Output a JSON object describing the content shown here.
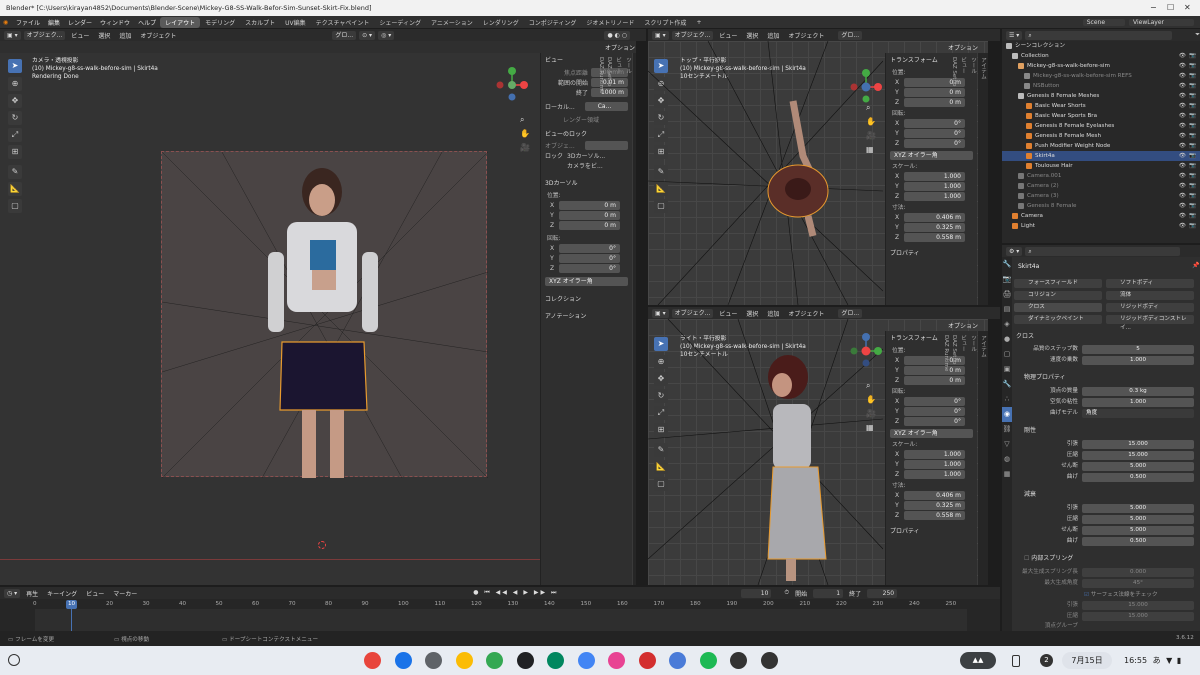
{
  "window": {
    "title": "Blender* [C:\\Users\\kirayan4852\\Documents\\Blender-Scene\\Mickey-G8-SS-Walk-Befor-Sim-Sunset-Skirt-Fix.blend]",
    "minimize": "−",
    "maximize": "☐",
    "close": "✕"
  },
  "menus": [
    "ファイル",
    "編集",
    "レンダー",
    "ウィンドウ",
    "ヘルプ"
  ],
  "workspaces": [
    "レイアウト",
    "モデリング",
    "スカルプト",
    "UV編集",
    "テクスチャペイント",
    "シェーディング",
    "アニメーション",
    "レンダリング",
    "コンポジティング",
    "ジオメトリノード",
    "スクリプト作成"
  ],
  "workspace_add": "+",
  "scene": {
    "name": "Scene",
    "view_layer": "ViewLayer"
  },
  "viewport_header": {
    "mode": "オブジェク...",
    "menus": [
      "ビュー",
      "選択",
      "追加",
      "オブジェクト"
    ],
    "transform": "グロ...",
    "options": "オプション"
  },
  "main_view": {
    "name": "カメラ・透視投影",
    "object": "(10) Mickey-g8-ss-walk-before-sim | Skirt4a",
    "status": "Rendering Done"
  },
  "top_view": {
    "name": "トップ・平行投影",
    "object": "(10) Mickey-g8-ss-walk-before-sim | Skirt4a",
    "scale": "10センチメートル"
  },
  "right_view": {
    "name": "ライト・平行投影",
    "object": "(10) Mickey-g8-ss-walk-before-sim | Skirt4a",
    "scale": "10センチメートル"
  },
  "view_panel": {
    "title": "ビュー",
    "focal_label": "焦点距離",
    "focal": "100 mm",
    "clip_start_label": "範囲の開始",
    "clip_start": "0.01 m",
    "clip_end_label": "終了",
    "clip_end": "1000 m",
    "local_camera_label": "ローカル...",
    "local_camera": "Ca...",
    "render_region": "レンダー領域",
    "lock_title": "ビューのロック",
    "lock_object_label": "オブジェ...",
    "lock_label": "ロック",
    "lock_3d_cursor": "3Dカーソル...",
    "camera_to_view": "カメラをビ...",
    "cursor_title": "3Dカーソル",
    "location_label": "位置:",
    "rotation_label": "回転:",
    "cursor_loc": [
      "0 m",
      "0 m",
      "0 m"
    ],
    "cursor_rot": [
      "0°",
      "0°",
      "0°"
    ],
    "rot_mode": "XYZ オイラー角",
    "collection": "コレクション",
    "annotation": "アノテーション"
  },
  "axes": [
    "X",
    "Y",
    "Z"
  ],
  "transform_panel": {
    "title": "トランスフォーム",
    "location_label": "位置:",
    "rotation_label": "回転:",
    "scale_label": "スケール:",
    "dims_label": "寸法:",
    "loc": [
      "0 m",
      "0 m",
      "0 m"
    ],
    "rot": [
      "0°",
      "0°",
      "0°"
    ],
    "rot_mode": "XYZ オイラー角",
    "scale": [
      "1.000",
      "1.000",
      "1.000"
    ],
    "dims": [
      "0.406 m",
      "0.325 m",
      "0.558 m"
    ],
    "properties": "プロパティ"
  },
  "side_tabs": [
    "アイテム",
    "ツール",
    "ビュー",
    "DAZ Setup",
    "DAZ Runtime"
  ],
  "outliner": {
    "root": "シーンコレクション",
    "items": [
      {
        "name": "Collection",
        "color": "#bbbbbb",
        "dim": false
      },
      {
        "name": "Mickey-g8-ss-walk-before-sim",
        "color": "#e0a060",
        "dim": false
      },
      {
        "name": "Mickey-g8-ss-walk-before-sim REFS",
        "color": "#888888",
        "dim": true
      },
      {
        "name": "NSButton",
        "color": "#888888",
        "dim": true
      },
      {
        "name": "Genesis 8 Female Meshes",
        "color": "#bbbbbb",
        "dim": false
      },
      {
        "name": "Basic Wear Shorts",
        "color": "#e08030",
        "dim": false
      },
      {
        "name": "Basic Wear Sports Bra",
        "color": "#e08030",
        "dim": false
      },
      {
        "name": "Genesis 8 Female Eyelashes",
        "color": "#e08030",
        "dim": false
      },
      {
        "name": "Genesis 8 Female Mesh",
        "color": "#e08030",
        "dim": false
      },
      {
        "name": "Push Modifier Weight Node",
        "color": "#e08030",
        "dim": false
      },
      {
        "name": "Skirt4a",
        "color": "#e08030",
        "dim": false,
        "selected": true
      },
      {
        "name": "Toulouse Hair",
        "color": "#e08030",
        "dim": false
      },
      {
        "name": "Camera.001",
        "color": "#777777",
        "dim": true
      },
      {
        "name": "Camera (2)",
        "color": "#777777",
        "dim": true
      },
      {
        "name": "Camera (3)",
        "color": "#777777",
        "dim": true
      },
      {
        "name": "Genesis 8 Female",
        "color": "#777777",
        "dim": true
      },
      {
        "name": "Camera",
        "color": "#e08030",
        "dim": false
      },
      {
        "name": "Light",
        "color": "#e08030",
        "dim": false
      }
    ]
  },
  "properties": {
    "object": "Skirt4a",
    "physics_buttons": [
      "フォースフィールド",
      "ソフトボディ",
      "コリジョン",
      "流体",
      "クロス",
      "リジッドボディ",
      "ダイナミックペイント",
      "リジッドボディコンストレイ..."
    ],
    "cloth_title": "クロス",
    "quality_label": "品質のステップ数",
    "quality": "5",
    "speed_label": "速度の乗数",
    "speed": "1.000",
    "phys_title": "物理プロパティ",
    "mass_label": "頂点の質量",
    "mass": "0.3 kg",
    "air_label": "空気の粘性",
    "air": "1.000",
    "bend_model_label": "曲げモデル",
    "bend_model": "角度",
    "stiff_title": "剛性",
    "tension_label": "引張",
    "tension": "15.000",
    "compress_label": "圧縮",
    "compress": "15.000",
    "shear_label": "せん断",
    "shear": "5.000",
    "bending_label": "曲げ",
    "bending": "0.500",
    "damp_title": "減衰",
    "d_tension": "5.000",
    "d_compress": "5.000",
    "d_shear": "5.000",
    "d_bending": "0.500",
    "spring_title": "内部スプリング",
    "max_len_label": "最大生成スプリング長",
    "max_len": "0.000",
    "max_angle_label": "最大生成角度",
    "max_angle": "45°",
    "surface_check": "サーフェス法線をチェック",
    "s_tension": "15.000",
    "s_compress": "15.000",
    "vgroup_label": "頂点グループ"
  },
  "timeline": {
    "menus": [
      "再生",
      "キーイング",
      "ビュー",
      "マーカー"
    ],
    "current": "10",
    "start_label": "開始",
    "start": "1",
    "end_label": "終了",
    "end": "250",
    "ticks": [
      "0",
      "10",
      "20",
      "30",
      "40",
      "50",
      "60",
      "70",
      "80",
      "90",
      "100",
      "110",
      "120",
      "130",
      "140",
      "150",
      "160",
      "170",
      "180",
      "190",
      "200",
      "210",
      "220",
      "230",
      "240",
      "250"
    ]
  },
  "status": {
    "left": "フレームを変更",
    "mid": "視点の移動",
    "right": "ドープシートコンテクストメニュー",
    "version": "3.6.12"
  },
  "taskbar": {
    "apps": [
      {
        "name": "chrome",
        "color": "#e8453c"
      },
      {
        "name": "files",
        "color": "#1a73e8"
      },
      {
        "name": "settings",
        "color": "#5f6368"
      },
      {
        "name": "photos",
        "color": "#fbbc04"
      },
      {
        "name": "dev",
        "color": "#34a853"
      },
      {
        "name": "terminal",
        "color": "#202124"
      },
      {
        "name": "play",
        "color": "#01875f"
      },
      {
        "name": "feedback",
        "color": "#4285f4"
      },
      {
        "name": "paint",
        "color": "#e84393"
      },
      {
        "name": "anydesk",
        "color": "#d32f2f"
      },
      {
        "name": "docs",
        "color": "#4a7bd8"
      },
      {
        "name": "spotify",
        "color": "#1db954"
      },
      {
        "name": "tux1",
        "color": "#333333"
      },
      {
        "name": "tux2",
        "color": "#333333"
      }
    ],
    "badge": "2",
    "date": "7月15日",
    "time": "16:55",
    "ime": "あ"
  }
}
